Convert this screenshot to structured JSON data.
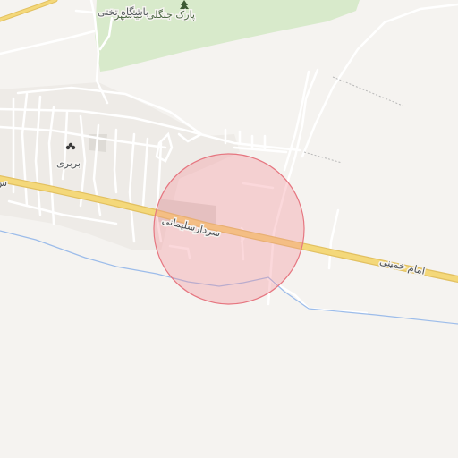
{
  "map": {
    "labels": {
      "park": "پارک جنگلی کیاشهر",
      "club": "باشگاه تختی",
      "village": "بربری",
      "road_west": "سردارسلیمانی",
      "road_east": "امام خمینی",
      "road_edge": "س"
    },
    "icons": {
      "park": "tree-icon",
      "village": "village-icon"
    },
    "colors": {
      "background": "#f5f3f0",
      "park_fill": "#d8eacb",
      "built_up": "#ebe8e4",
      "building": "#dedbd6",
      "minor_road": "#ffffff",
      "main_road": "#f4d87a",
      "main_road_casing": "#e2c060",
      "waterway": "#9cbcea",
      "circle_fill": "#f48e98",
      "circle_stroke": "#e67680"
    }
  }
}
